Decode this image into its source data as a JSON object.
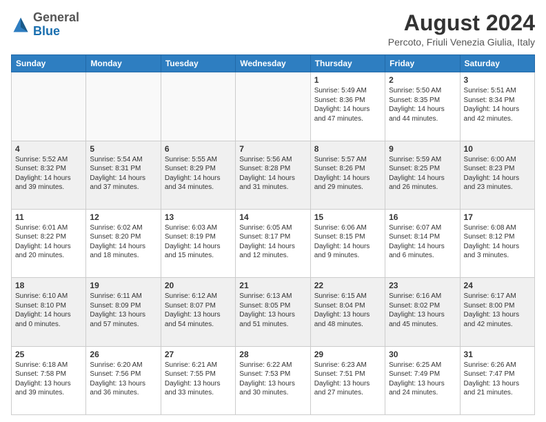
{
  "header": {
    "logo": {
      "general": "General",
      "blue": "Blue"
    },
    "title": "August 2024",
    "location": "Percoto, Friuli Venezia Giulia, Italy"
  },
  "days_of_week": [
    "Sunday",
    "Monday",
    "Tuesday",
    "Wednesday",
    "Thursday",
    "Friday",
    "Saturday"
  ],
  "weeks": [
    [
      {
        "day": "",
        "empty": true
      },
      {
        "day": "",
        "empty": true
      },
      {
        "day": "",
        "empty": true
      },
      {
        "day": "",
        "empty": true
      },
      {
        "day": "1",
        "sunrise": "5:49 AM",
        "sunset": "8:36 PM",
        "daylight": "14 hours and 47 minutes."
      },
      {
        "day": "2",
        "sunrise": "5:50 AM",
        "sunset": "8:35 PM",
        "daylight": "14 hours and 44 minutes."
      },
      {
        "day": "3",
        "sunrise": "5:51 AM",
        "sunset": "8:34 PM",
        "daylight": "14 hours and 42 minutes."
      }
    ],
    [
      {
        "day": "4",
        "sunrise": "5:52 AM",
        "sunset": "8:32 PM",
        "daylight": "14 hours and 39 minutes."
      },
      {
        "day": "5",
        "sunrise": "5:54 AM",
        "sunset": "8:31 PM",
        "daylight": "14 hours and 37 minutes."
      },
      {
        "day": "6",
        "sunrise": "5:55 AM",
        "sunset": "8:29 PM",
        "daylight": "14 hours and 34 minutes."
      },
      {
        "day": "7",
        "sunrise": "5:56 AM",
        "sunset": "8:28 PM",
        "daylight": "14 hours and 31 minutes."
      },
      {
        "day": "8",
        "sunrise": "5:57 AM",
        "sunset": "8:26 PM",
        "daylight": "14 hours and 29 minutes."
      },
      {
        "day": "9",
        "sunrise": "5:59 AM",
        "sunset": "8:25 PM",
        "daylight": "14 hours and 26 minutes."
      },
      {
        "day": "10",
        "sunrise": "6:00 AM",
        "sunset": "8:23 PM",
        "daylight": "14 hours and 23 minutes."
      }
    ],
    [
      {
        "day": "11",
        "sunrise": "6:01 AM",
        "sunset": "8:22 PM",
        "daylight": "14 hours and 20 minutes."
      },
      {
        "day": "12",
        "sunrise": "6:02 AM",
        "sunset": "8:20 PM",
        "daylight": "14 hours and 18 minutes."
      },
      {
        "day": "13",
        "sunrise": "6:03 AM",
        "sunset": "8:19 PM",
        "daylight": "14 hours and 15 minutes."
      },
      {
        "day": "14",
        "sunrise": "6:05 AM",
        "sunset": "8:17 PM",
        "daylight": "14 hours and 12 minutes."
      },
      {
        "day": "15",
        "sunrise": "6:06 AM",
        "sunset": "8:15 PM",
        "daylight": "14 hours and 9 minutes."
      },
      {
        "day": "16",
        "sunrise": "6:07 AM",
        "sunset": "8:14 PM",
        "daylight": "14 hours and 6 minutes."
      },
      {
        "day": "17",
        "sunrise": "6:08 AM",
        "sunset": "8:12 PM",
        "daylight": "14 hours and 3 minutes."
      }
    ],
    [
      {
        "day": "18",
        "sunrise": "6:10 AM",
        "sunset": "8:10 PM",
        "daylight": "14 hours and 0 minutes."
      },
      {
        "day": "19",
        "sunrise": "6:11 AM",
        "sunset": "8:09 PM",
        "daylight": "13 hours and 57 minutes."
      },
      {
        "day": "20",
        "sunrise": "6:12 AM",
        "sunset": "8:07 PM",
        "daylight": "13 hours and 54 minutes."
      },
      {
        "day": "21",
        "sunrise": "6:13 AM",
        "sunset": "8:05 PM",
        "daylight": "13 hours and 51 minutes."
      },
      {
        "day": "22",
        "sunrise": "6:15 AM",
        "sunset": "8:04 PM",
        "daylight": "13 hours and 48 minutes."
      },
      {
        "day": "23",
        "sunrise": "6:16 AM",
        "sunset": "8:02 PM",
        "daylight": "13 hours and 45 minutes."
      },
      {
        "day": "24",
        "sunrise": "6:17 AM",
        "sunset": "8:00 PM",
        "daylight": "13 hours and 42 minutes."
      }
    ],
    [
      {
        "day": "25",
        "sunrise": "6:18 AM",
        "sunset": "7:58 PM",
        "daylight": "13 hours and 39 minutes."
      },
      {
        "day": "26",
        "sunrise": "6:20 AM",
        "sunset": "7:56 PM",
        "daylight": "13 hours and 36 minutes."
      },
      {
        "day": "27",
        "sunrise": "6:21 AM",
        "sunset": "7:55 PM",
        "daylight": "13 hours and 33 minutes."
      },
      {
        "day": "28",
        "sunrise": "6:22 AM",
        "sunset": "7:53 PM",
        "daylight": "13 hours and 30 minutes."
      },
      {
        "day": "29",
        "sunrise": "6:23 AM",
        "sunset": "7:51 PM",
        "daylight": "13 hours and 27 minutes."
      },
      {
        "day": "30",
        "sunrise": "6:25 AM",
        "sunset": "7:49 PM",
        "daylight": "13 hours and 24 minutes."
      },
      {
        "day": "31",
        "sunrise": "6:26 AM",
        "sunset": "7:47 PM",
        "daylight": "13 hours and 21 minutes."
      }
    ]
  ]
}
